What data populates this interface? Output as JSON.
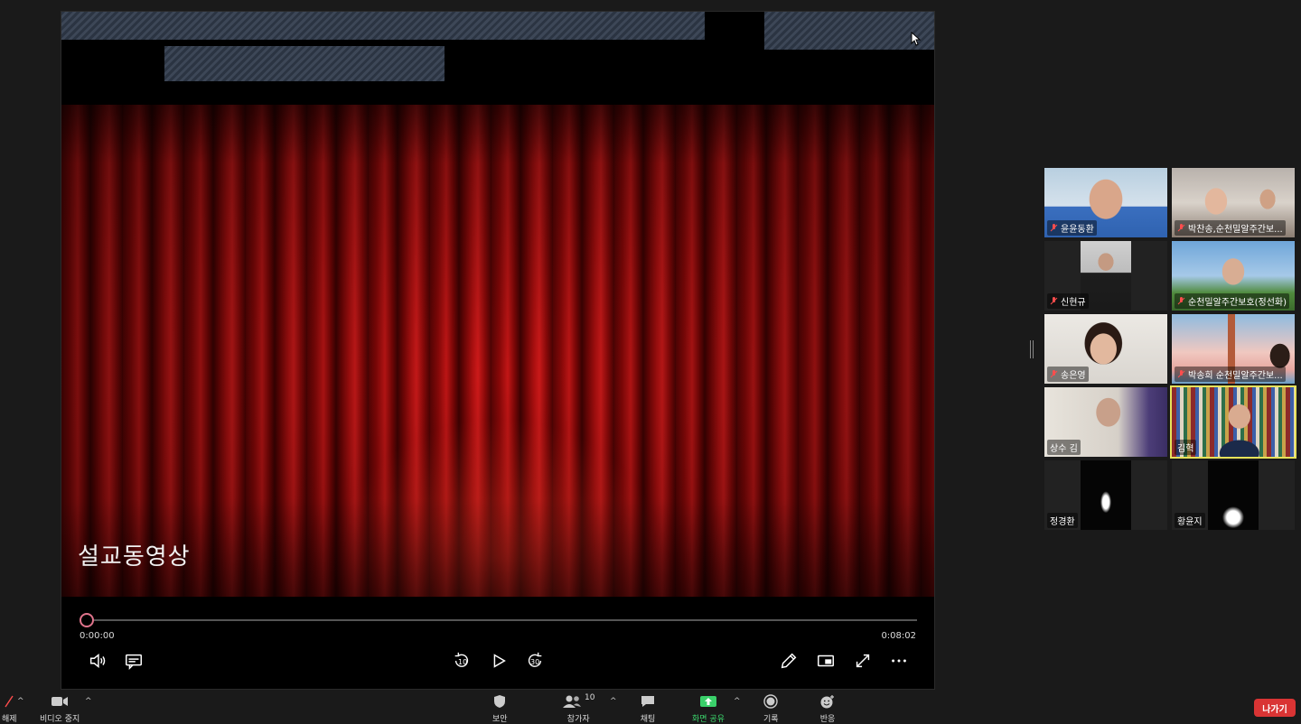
{
  "share": {
    "video_title": "설교동영상",
    "time_current": "0:00:00",
    "time_total": "0:08:02",
    "progress_fraction": 0,
    "rewind_label": "10",
    "forward_label": "30"
  },
  "gallery": {
    "participants": [
      {
        "name": "윤윤동환",
        "muted": true,
        "active": false
      },
      {
        "name": "박찬송,순천밀알주간보...",
        "muted": true,
        "active": false
      },
      {
        "name": "신현규",
        "muted": true,
        "active": false
      },
      {
        "name": "순천밀알주간보호(정선화)",
        "muted": true,
        "active": false
      },
      {
        "name": "송은영",
        "muted": true,
        "active": false
      },
      {
        "name": "박송희 순천밀알주간보...",
        "muted": true,
        "active": false
      },
      {
        "name": "상수 김",
        "muted": false,
        "active": false
      },
      {
        "name": "김혁",
        "muted": false,
        "active": true
      },
      {
        "name": "정경환",
        "muted": false,
        "active": false
      },
      {
        "name": "황윤지",
        "muted": false,
        "active": false
      }
    ]
  },
  "toolbar": {
    "unmute_label": "해제",
    "video_label": "비디오 중지",
    "security_label": "보안",
    "participants_label": "참가자",
    "participants_count": "10",
    "chat_label": "채팅",
    "share_label": "화면 공유",
    "record_label": "기록",
    "reactions_label": "반응",
    "leave_label": "나가기"
  },
  "colors": {
    "accent_share": "#3ad06a",
    "leave": "#d93434",
    "active_speaker": "#e6e25a"
  }
}
